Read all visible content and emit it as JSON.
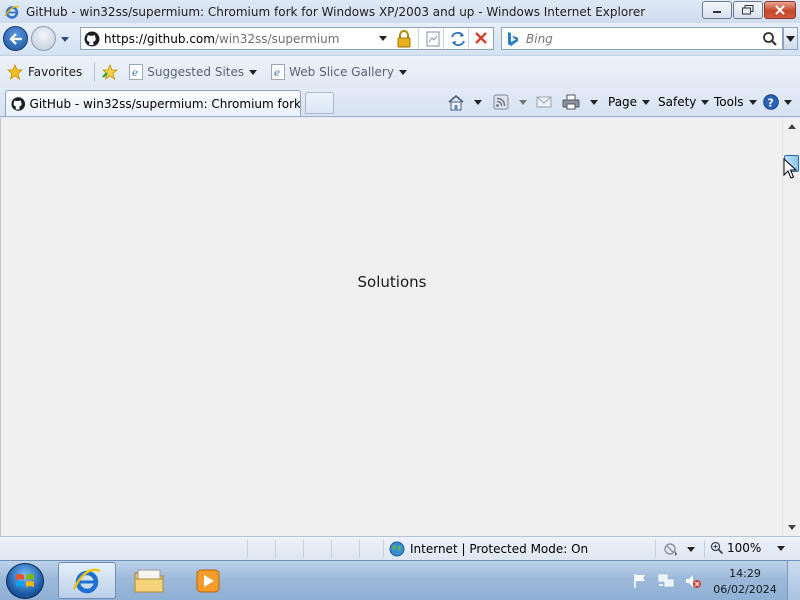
{
  "window": {
    "title": "GitHub - win32ss/supermium: Chromium fork for Windows XP/2003 and up - Windows Internet Explorer"
  },
  "address": {
    "url_host": "https://github.com",
    "url_path": "/win32ss/supermium"
  },
  "search": {
    "placeholder": "Bing"
  },
  "favorites": {
    "favorites_label": "Favorites",
    "items": [
      {
        "label": "Suggested Sites"
      },
      {
        "label": "Web Slice Gallery"
      }
    ]
  },
  "tabs": [
    {
      "label": "GitHub - win32ss/supermium: Chromium fork fo...",
      "active": true
    }
  ],
  "commandbar": {
    "page_label": "Page",
    "safety_label": "Safety",
    "tools_label": "Tools"
  },
  "content": {
    "text": "Solutions"
  },
  "statusbar": {
    "zone_label": "Internet | Protected Mode: On",
    "zoom_label": "100%"
  },
  "taskbar": {
    "time": "14:29",
    "date": "06/02/2024"
  },
  "colors": {
    "content_bg": "#f0f0f0",
    "chrome_bg": "#dbe6f4",
    "taskbar_bg": "#9cb9da"
  },
  "icons": [
    "ie-icon",
    "minimize-icon",
    "maximize-icon",
    "close-icon",
    "back-arrow-icon",
    "forward-arrow-icon",
    "github-icon",
    "lock-icon",
    "compatibility-icon",
    "refresh-icon",
    "stop-icon",
    "bing-icon",
    "search-icon",
    "favorites-star-icon",
    "add-favorites-icon",
    "home-icon",
    "feeds-icon",
    "mail-icon",
    "print-icon",
    "help-icon",
    "globe-icon",
    "zoom-icon",
    "windows-logo-icon",
    "folder-icon",
    "media-player-icon",
    "flag-icon",
    "network-icon",
    "volume-muted-icon"
  ]
}
